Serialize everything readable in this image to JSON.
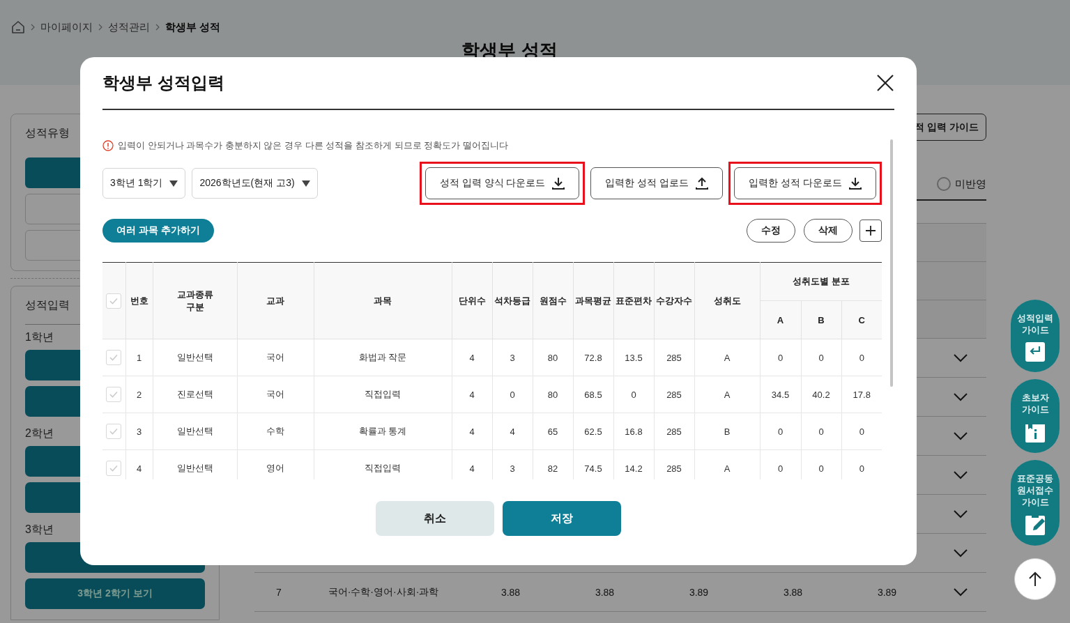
{
  "breadcrumb": [
    {
      "label": "마이페이지",
      "current": false
    },
    {
      "label": "성적관리",
      "current": false
    },
    {
      "label": "학생부 성적",
      "current": true
    }
  ],
  "page_title": "학생부 성적",
  "sidebar": {
    "score_type": {
      "title": "성적유형",
      "options": [
        {
          "selected": true
        },
        {
          "selected": false
        },
        {
          "selected": false
        }
      ]
    },
    "score_input": {
      "title": "성적입력",
      "years": [
        {
          "label": "1학년",
          "buttons": [
            {
              "kind": "view"
            },
            {
              "kind": "view"
            }
          ]
        },
        {
          "label": "2학년",
          "buttons": [
            {
              "kind": "view"
            },
            {
              "kind": "view"
            }
          ]
        },
        {
          "label": "3학년",
          "buttons": [
            {
              "kind": "view"
            },
            {
              "kind": "view",
              "label": "3학년 2학기 보기"
            }
          ]
        }
      ]
    }
  },
  "main": {
    "guide_button": "적 입력 가이드",
    "filter": {
      "label": "미반영",
      "selected": false
    },
    "rows": [
      {
        "expanded": false
      },
      {
        "expanded": false
      },
      {
        "expanded": false
      },
      {
        "expanded": false
      },
      {
        "expanded": false
      },
      {
        "expanded": false
      },
      {
        "expanded": false,
        "cells": [
          "7",
          "국어·수학·영어·사회·과학",
          "3.88",
          "3.88",
          "3.89",
          "3.88",
          "3.89"
        ]
      }
    ]
  },
  "floating_buttons": [
    {
      "kind": "enter",
      "lines": [
        "성적입력",
        "가이드"
      ]
    },
    {
      "kind": "info",
      "lines": [
        "초보자",
        "가이드"
      ]
    },
    {
      "kind": "edit",
      "lines": [
        "표준공동",
        "원서접수",
        "가이드"
      ]
    }
  ],
  "modal": {
    "title": "학생부 성적입력",
    "notice": "입력이 안되거나 과목수가 충분하지 않은 경우 다른 성적을 참조하게 되므로 정확도가 떨어집니다",
    "selects": [
      {
        "value": "3학년 1학기"
      },
      {
        "value": "2026학년도(현재 고3)"
      }
    ],
    "file_buttons": [
      {
        "label": "성적 입력 양식 다운로드",
        "kind": "download",
        "highlighted": true
      },
      {
        "label": "입력한 성적 업로드",
        "kind": "upload",
        "highlighted": false
      },
      {
        "label": "입력한 성적 다운로드",
        "kind": "download",
        "highlighted": true
      }
    ],
    "add_many_button": "여러 과목 추가하기",
    "edit_button": "수정",
    "delete_button": "삭제",
    "table": {
      "header_checked": false,
      "columns": [
        "번호",
        "교과종류 구분",
        "교과",
        "과목",
        "단위수",
        "석차등급",
        "원점수",
        "과목평균",
        "표준편차",
        "수강자수",
        "성취도"
      ],
      "group_column": {
        "label": "성취도별 분포",
        "subcolumns": [
          "A",
          "B",
          "C"
        ]
      },
      "rows": [
        {
          "checked": false,
          "cells": [
            "1",
            "일반선택",
            "국어",
            "화법과 작문",
            "4",
            "3",
            "80",
            "72.8",
            "13.5",
            "285",
            "A",
            "0",
            "0",
            "0"
          ]
        },
        {
          "checked": false,
          "cells": [
            "2",
            "진로선택",
            "국어",
            "직접입력",
            "4",
            "0",
            "80",
            "68.5",
            "0",
            "285",
            "A",
            "34.5",
            "40.2",
            "17.8"
          ]
        },
        {
          "checked": false,
          "cells": [
            "3",
            "일반선택",
            "수학",
            "확률과 통계",
            "4",
            "4",
            "65",
            "62.5",
            "16.8",
            "285",
            "B",
            "0",
            "0",
            "0"
          ]
        },
        {
          "checked": false,
          "cells": [
            "4",
            "일반선택",
            "영어",
            "직접입력",
            "4",
            "3",
            "82",
            "74.5",
            "14.2",
            "285",
            "A",
            "0",
            "0",
            "0"
          ]
        }
      ]
    },
    "footer_buttons": [
      {
        "label": "취소",
        "kind": "secondary"
      },
      {
        "label": "저장",
        "kind": "primary"
      }
    ]
  }
}
